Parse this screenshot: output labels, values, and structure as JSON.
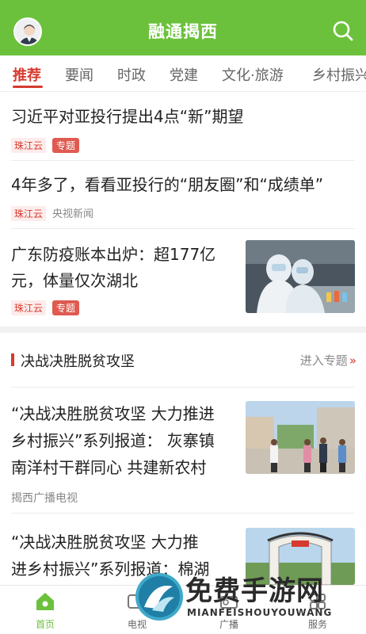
{
  "header": {
    "title": "融通揭西"
  },
  "tabs": [
    {
      "label": "推荐"
    },
    {
      "label": "要闻"
    },
    {
      "label": "时政"
    },
    {
      "label": "党建"
    },
    {
      "label": "文化·旅游"
    },
    {
      "label": "乡村振兴"
    }
  ],
  "news": [
    {
      "title": "习近平对亚投行提出4点“新”期望",
      "source": "珠江云",
      "tag": "专题"
    },
    {
      "title": "4年多了，看看亚投行的“朋友圈”和“成绩单”",
      "source": "珠江云",
      "source2": "央视新闻"
    },
    {
      "title_line1": "广东防疫账本出炉：超177亿",
      "title_line2": "元，体量仅次湖北",
      "source": "珠江云",
      "tag": "专题"
    }
  ],
  "section": {
    "title": "决战决胜脱贫攻坚",
    "more": "进入专题",
    "more_icon": "»"
  },
  "section_news": [
    {
      "title_line1": "“决战决胜脱贫攻坚 大力推进",
      "title_line2": "乡村振兴”系列报道： 灰寨镇",
      "title_line3": "南洋村干群同心 共建新农村",
      "source": "揭西广播电视"
    },
    {
      "title_line1": "“决战决胜脱贫攻坚  大力推",
      "title_line2": "进乡村振兴”系列报道：棉湖"
    }
  ],
  "bottom_nav": [
    {
      "label": "首页",
      "icon": "home-icon"
    },
    {
      "label": "电视",
      "icon": "tv-icon"
    },
    {
      "label": "广播",
      "icon": "radio-icon"
    },
    {
      "label": "服务",
      "icon": "service-icon"
    }
  ],
  "watermark": {
    "text": "免费手游网",
    "sub": "MIANFEISHOUYOUWANG"
  },
  "colors": {
    "brand_green": "#6cc13c",
    "accent_red": "#d63b2f"
  }
}
